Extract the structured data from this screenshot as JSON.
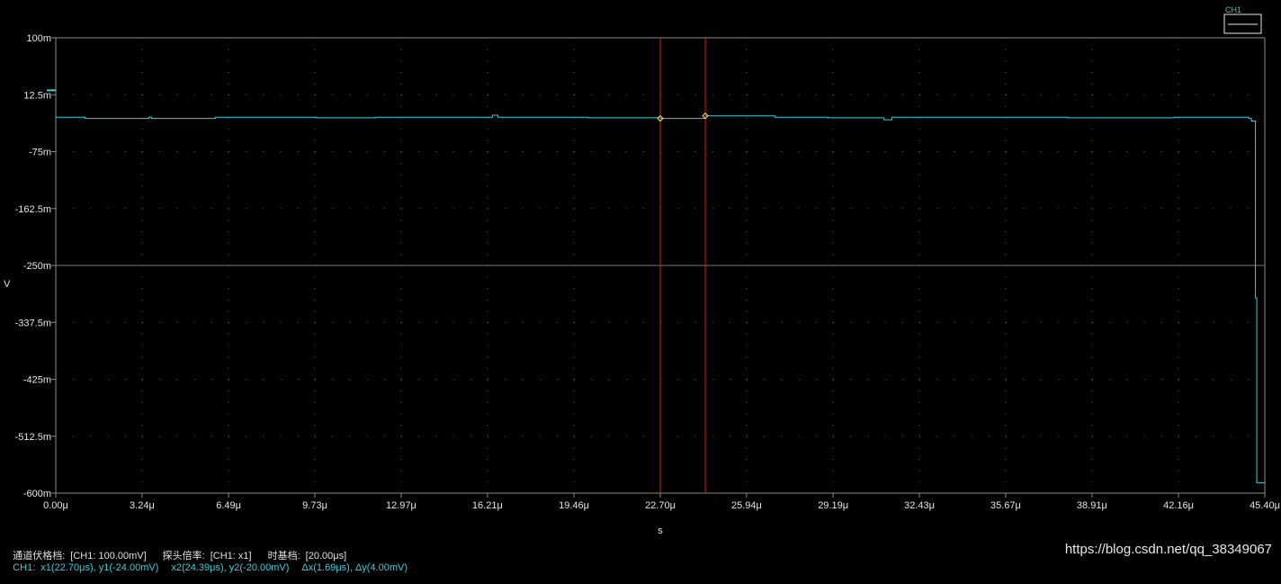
{
  "legend": {
    "channel_label": "CH1"
  },
  "status": {
    "channel_scale_label": "通道伏格档:",
    "channel_scale_value": "[CH1: 100.00mV]",
    "probe_label": "探头倍率:",
    "probe_value": "[CH1: x1]",
    "timebase_label": "时基档:",
    "timebase_value": "[20.00μs]",
    "cursor_channel": "CH1:",
    "cursor_x1y1": "x1(22.70μs), y1(-24.00mV)",
    "cursor_x2y2": "x2(24.39μs), y2(-20.00mV)",
    "cursor_delta": "Δx(1.69μs), Δy(4.00mV)"
  },
  "watermark": "https://blog.csdn.net/qq_38349067",
  "colors": {
    "background": "#000000",
    "plot_border": "#8a8a8a",
    "grid_dots": "#6a6a6a",
    "center_lines": "#7a7a7a",
    "axis_text": "#e6e6e6",
    "trace": "#2fd3e0",
    "cursor": "#e01818",
    "cursor_marker": "#e8e85a"
  },
  "chart_data": {
    "type": "line",
    "xlabel": "s",
    "ylabel": "V",
    "xlim": [
      0,
      45.4
    ],
    "ylim": [
      -0.6,
      0.1
    ],
    "x_ticks": [
      0,
      3.24,
      6.49,
      9.73,
      12.97,
      16.21,
      19.46,
      22.7,
      25.94,
      29.19,
      32.43,
      35.67,
      38.91,
      42.16,
      45.4
    ],
    "x_tick_labels": [
      "0.00μ",
      "3.24μ",
      "6.49μ",
      "9.73μ",
      "12.97μ",
      "16.21μ",
      "19.46μ",
      "22.70μ",
      "25.94μ",
      "29.19μ",
      "32.43μ",
      "35.67μ",
      "38.91μ",
      "42.16μ",
      "45.40μ"
    ],
    "y_ticks": [
      0.1,
      0.0125,
      -0.075,
      -0.1625,
      -0.25,
      -0.3375,
      -0.425,
      -0.5125,
      -0.6
    ],
    "y_tick_labels": [
      "100m",
      "12.5m",
      "-75m",
      "-162.5m",
      "-250m",
      "-337.5m",
      "-425m",
      "-512.5m",
      "-600m"
    ],
    "grid": true,
    "ground_marker_v": 0,
    "series": [
      {
        "name": "CH1",
        "x": [
          0,
          1.0,
          1.1,
          3.5,
          3.6,
          6.0,
          9.8,
          12.0,
          16.2,
          16.4,
          16.6,
          20.0,
          22.7,
          24.39,
          27.0,
          29.0,
          31.0,
          31.1,
          31.4,
          34.0,
          38.0,
          42.0,
          44.6,
          44.8,
          44.9,
          45.0,
          45.05,
          45.1,
          45.4
        ],
        "y": [
          -0.022,
          -0.022,
          -0.024,
          -0.022,
          -0.024,
          -0.022,
          -0.023,
          -0.022,
          -0.022,
          -0.019,
          -0.022,
          -0.023,
          -0.024,
          -0.02,
          -0.022,
          -0.023,
          -0.023,
          -0.026,
          -0.022,
          -0.022,
          -0.023,
          -0.022,
          -0.022,
          -0.024,
          -0.028,
          -0.028,
          -0.3,
          -0.584,
          -0.584
        ]
      }
    ],
    "cursors": [
      {
        "x": 22.7,
        "y": -0.024
      },
      {
        "x": 24.39,
        "y": -0.02
      }
    ]
  }
}
